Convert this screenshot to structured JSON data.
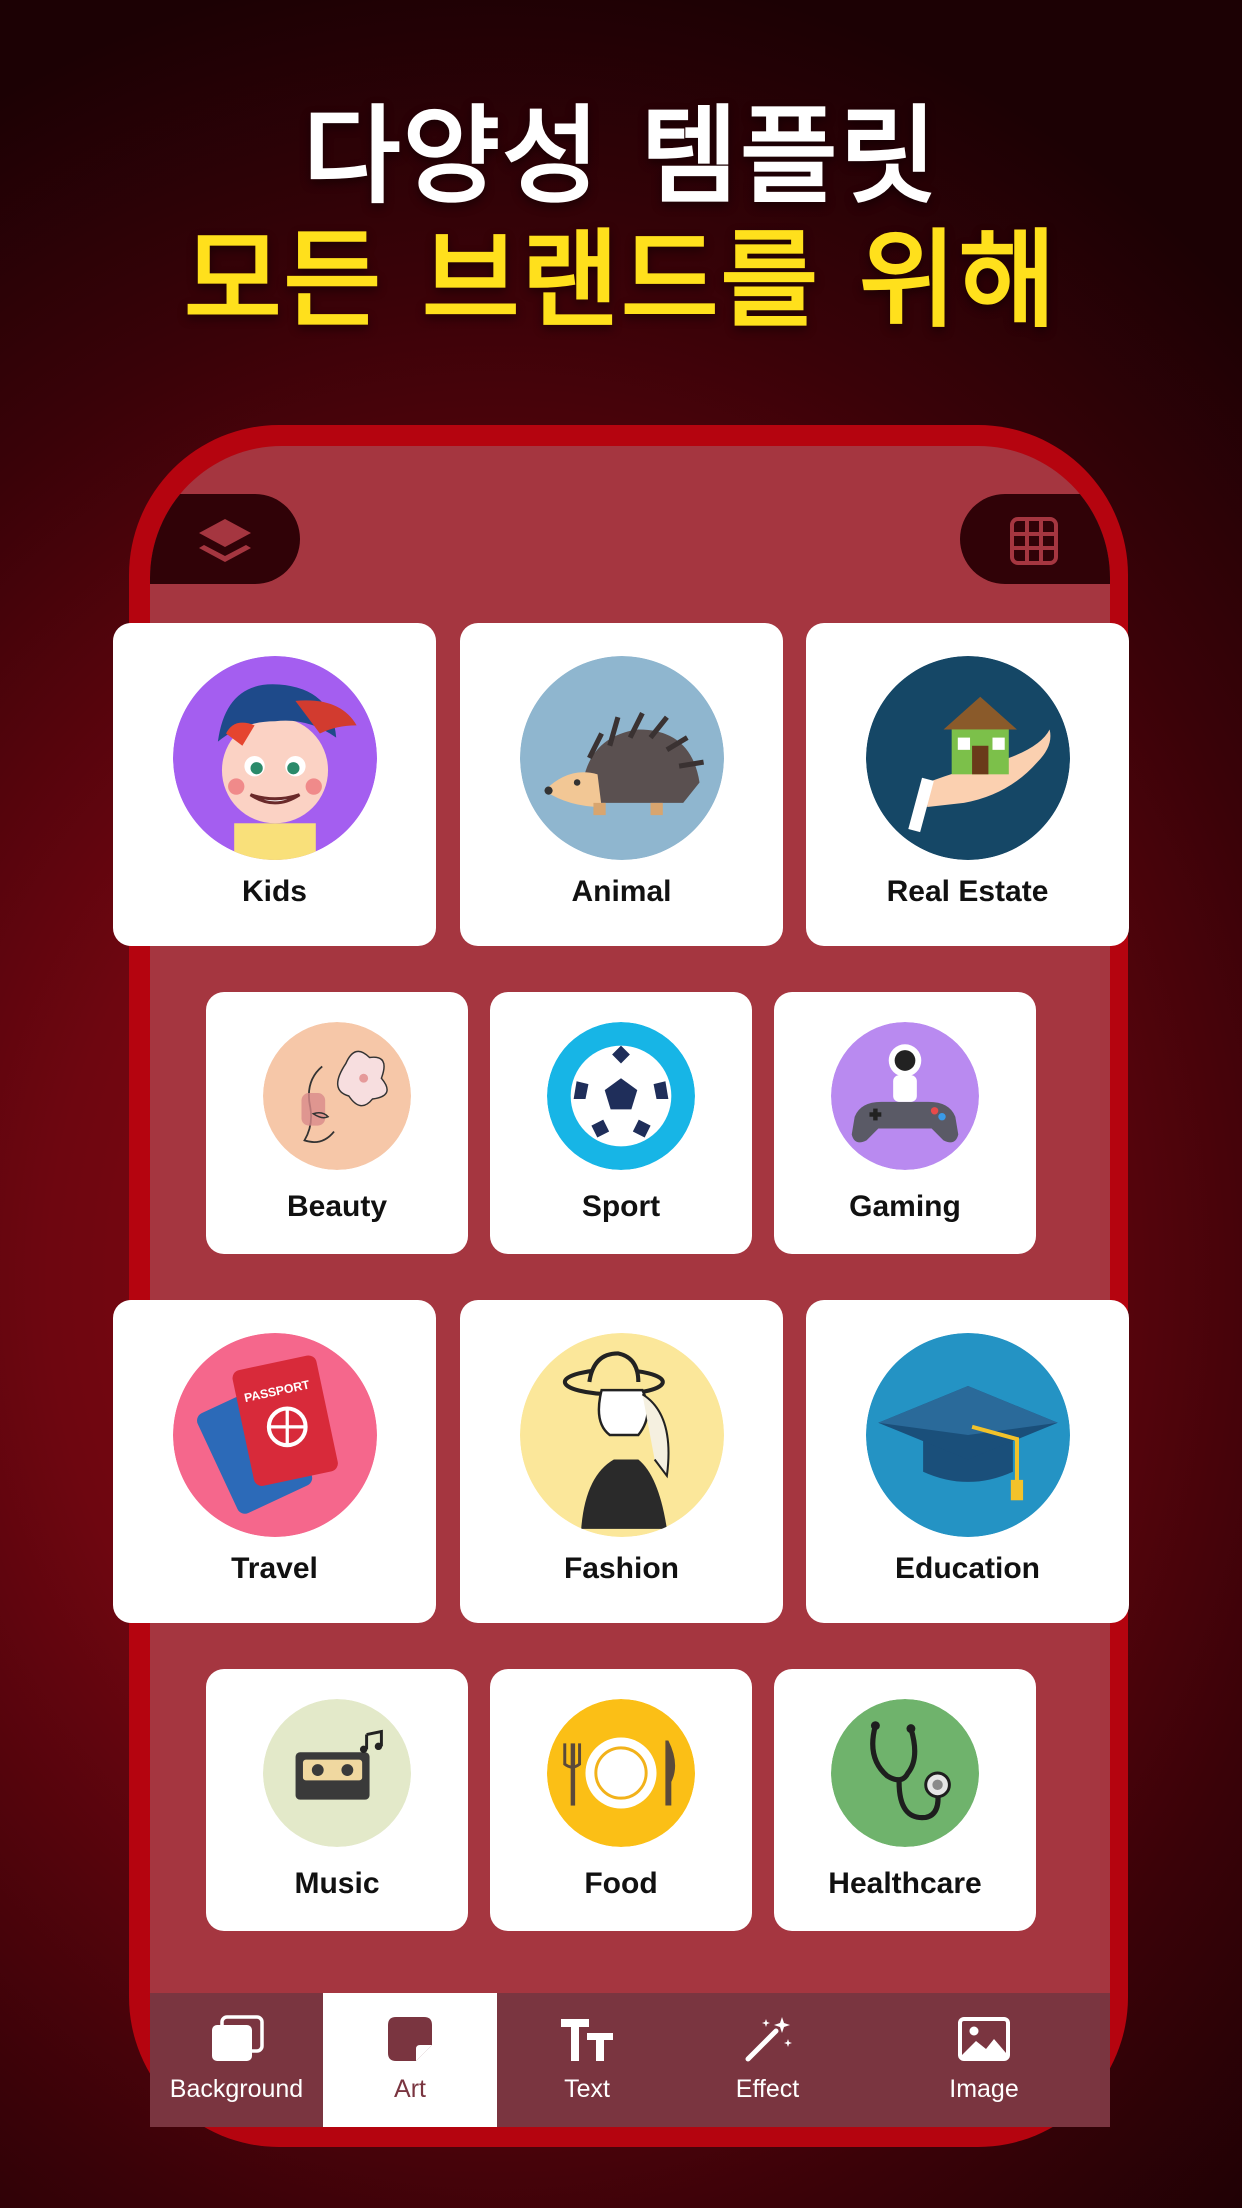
{
  "headline": {
    "line1": "다양성 템플릿",
    "line2": "모든 브랜드를 위해"
  },
  "toolbar": {
    "layers_icon": "layers-icon",
    "grid_icon": "grid-icon"
  },
  "categories": [
    {
      "label": "Kids",
      "icon": "kid-face-icon",
      "bg": "#a45ef0"
    },
    {
      "label": "Animal",
      "icon": "hedgehog-icon",
      "bg": "#8fb6cf"
    },
    {
      "label": "Real Estate",
      "icon": "house-in-hand-icon",
      "bg": "#154766"
    },
    {
      "label": "Beauty",
      "icon": "face-flower-icon",
      "bg": "#f6c7a8"
    },
    {
      "label": "Sport",
      "icon": "soccer-ball-icon",
      "bg": "#17b5e6"
    },
    {
      "label": "Gaming",
      "icon": "astronaut-gamepad-icon",
      "bg": "#b98af0"
    },
    {
      "label": "Travel",
      "icon": "passport-icon",
      "bg": "#f5678c"
    },
    {
      "label": "Fashion",
      "icon": "woman-hat-icon",
      "bg": "#fbe79a"
    },
    {
      "label": "Education",
      "icon": "graduation-cap-icon",
      "bg": "#2493c4"
    },
    {
      "label": "Music",
      "icon": "cassette-icon",
      "bg": "#e3e9c9"
    },
    {
      "label": "Food",
      "icon": "plate-fork-knife-icon",
      "bg": "#fbbf16"
    },
    {
      "label": "Healthcare",
      "icon": "stethoscope-icon",
      "bg": "#6fb36c"
    }
  ],
  "tabs": [
    {
      "label": "Background",
      "icon": "background-icon",
      "active": false
    },
    {
      "label": "Art",
      "icon": "sticker-icon",
      "active": true
    },
    {
      "label": "Text",
      "icon": "text-icon",
      "active": false
    },
    {
      "label": "Effect",
      "icon": "magic-wand-icon",
      "active": false
    },
    {
      "label": "Image",
      "icon": "image-icon",
      "active": false
    }
  ],
  "colors": {
    "accent_yellow": "#ffe01c",
    "frame_red": "#b5040f",
    "screen_bg": "#a53640",
    "tabbar_bg": "#7a3540"
  }
}
